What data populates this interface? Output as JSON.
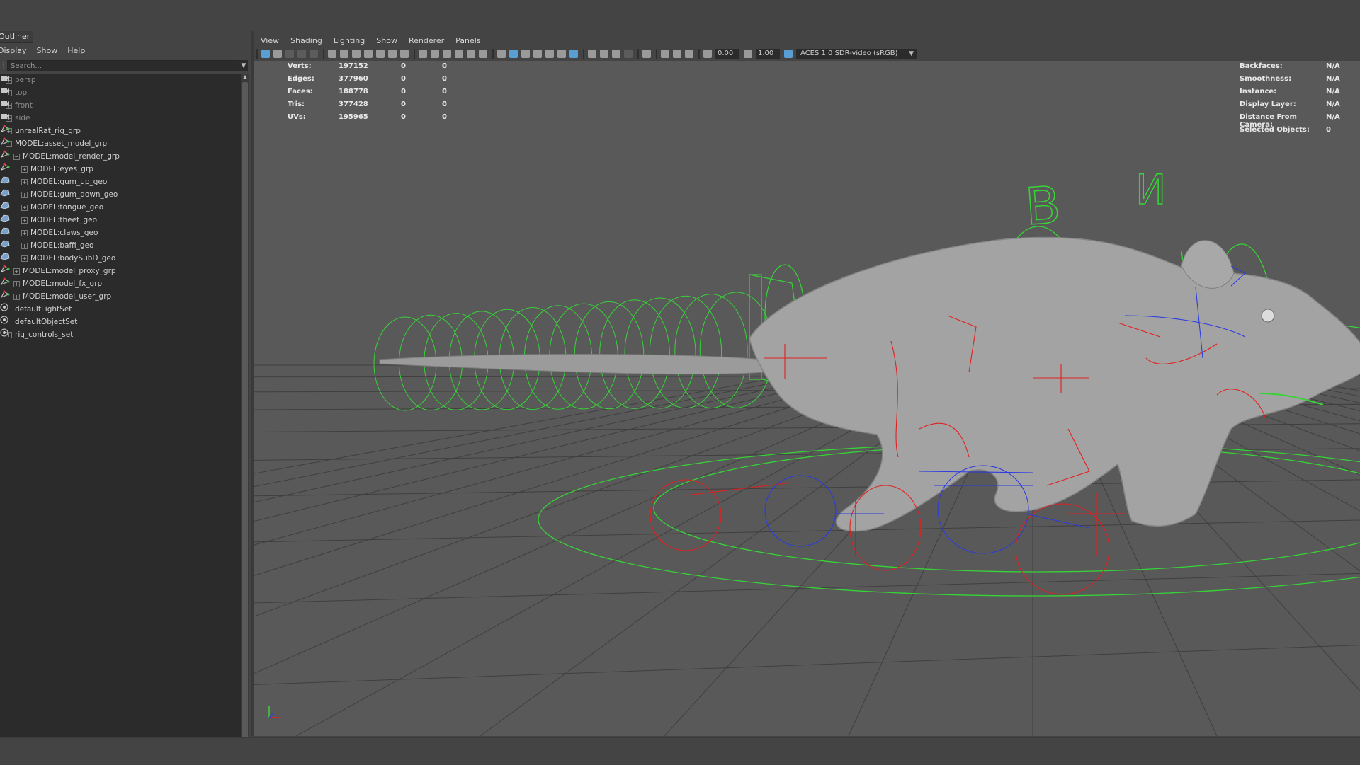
{
  "outliner": {
    "title": "Outliner",
    "menu": [
      "Display",
      "Show",
      "Help"
    ],
    "search_placeholder": "Search...",
    "items": [
      {
        "label": "persp",
        "depth": 0,
        "type": "camera",
        "dim": true
      },
      {
        "label": "top",
        "depth": 0,
        "type": "camera",
        "dim": true
      },
      {
        "label": "front",
        "depth": 0,
        "type": "camera",
        "dim": true
      },
      {
        "label": "side",
        "depth": 0,
        "type": "camera",
        "dim": true
      },
      {
        "label": "unrealRat_rig_grp",
        "depth": 0,
        "type": "group"
      },
      {
        "label": "MODEL:asset_model_grp",
        "depth": 0,
        "type": "group"
      },
      {
        "label": "MODEL:model_render_grp",
        "depth": 1,
        "type": "group"
      },
      {
        "label": "MODEL:eyes_grp",
        "depth": 2,
        "type": "group"
      },
      {
        "label": "MODEL:gum_up_geo",
        "depth": 2,
        "type": "mesh"
      },
      {
        "label": "MODEL:gum_down_geo",
        "depth": 2,
        "type": "mesh"
      },
      {
        "label": "MODEL:tongue_geo",
        "depth": 2,
        "type": "mesh"
      },
      {
        "label": "MODEL:theet_geo",
        "depth": 2,
        "type": "mesh"
      },
      {
        "label": "MODEL:claws_geo",
        "depth": 2,
        "type": "mesh"
      },
      {
        "label": "MODEL:baffi_geo",
        "depth": 2,
        "type": "mesh"
      },
      {
        "label": "MODEL:bodySubD_geo",
        "depth": 2,
        "type": "mesh"
      },
      {
        "label": "MODEL:model_proxy_grp",
        "depth": 1,
        "type": "group"
      },
      {
        "label": "MODEL:model_fx_grp",
        "depth": 1,
        "type": "group"
      },
      {
        "label": "MODEL:model_user_grp",
        "depth": 1,
        "type": "group"
      },
      {
        "label": "defaultLightSet",
        "depth": 0,
        "type": "set"
      },
      {
        "label": "defaultObjectSet",
        "depth": 0,
        "type": "set"
      },
      {
        "label": "rig_controls_set",
        "depth": 0,
        "type": "set"
      }
    ]
  },
  "viewport": {
    "menu": [
      "View",
      "Shading",
      "Lighting",
      "Show",
      "Renderer",
      "Panels"
    ],
    "exposure": "0.00",
    "gamma": "1.00",
    "color_space": "ACES 1.0 SDR-video (sRGB)",
    "hud_left": [
      {
        "label": "Verts:",
        "v1": "197152",
        "v2": "0",
        "v3": "0"
      },
      {
        "label": "Edges:",
        "v1": "377960",
        "v2": "0",
        "v3": "0"
      },
      {
        "label": "Faces:",
        "v1": "188778",
        "v2": "0",
        "v3": "0"
      },
      {
        "label": "Tris:",
        "v1": "377428",
        "v2": "0",
        "v3": "0"
      },
      {
        "label": "UVs:",
        "v1": "195965",
        "v2": "0",
        "v3": "0"
      }
    ],
    "hud_right": [
      {
        "label": "Backfaces:",
        "value": "N/A"
      },
      {
        "label": "Smoothness:",
        "value": "N/A"
      },
      {
        "label": "Instance:",
        "value": "N/A"
      },
      {
        "label": "Display Layer:",
        "value": "N/A"
      },
      {
        "label": "Distance From Camera:",
        "value": "N/A"
      },
      {
        "label": "Selected Objects:",
        "value": "0"
      }
    ],
    "control_letters": [
      "B",
      "И"
    ],
    "colors": {
      "controls_green": "#37d437",
      "controls_red": "#e02020",
      "controls_blue": "#2a3be0",
      "grid": "#3f3f3f",
      "background": "#595959"
    }
  }
}
